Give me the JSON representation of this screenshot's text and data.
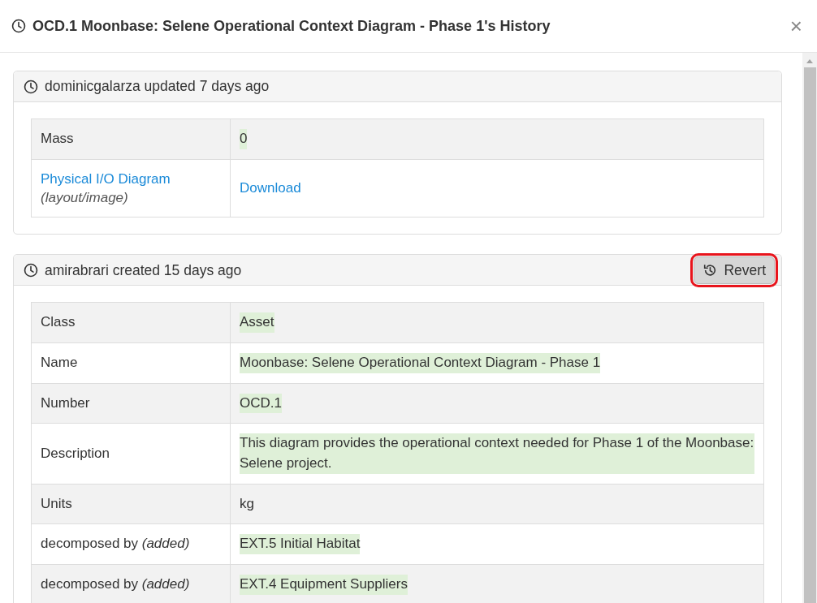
{
  "dialog": {
    "title": "OCD.1 Moonbase: Selene Operational Context Diagram - Phase 1's History",
    "close": "×"
  },
  "entries": [
    {
      "summary": "dominicgalarza updated 7 days ago",
      "rows": [
        {
          "kind": "field",
          "label": "Mass",
          "value": "0",
          "highlighted": true
        },
        {
          "kind": "attachment",
          "label": "Physical I/O Diagram",
          "sublabel": "(layout/image)",
          "value": "Download",
          "highlighted": false
        }
      ]
    },
    {
      "summary": "amirabrari created 15 days ago",
      "action": {
        "label": "Revert",
        "outlined": true
      },
      "rows": [
        {
          "kind": "field",
          "label": "Class",
          "value": "Asset",
          "highlighted": true
        },
        {
          "kind": "field",
          "label": "Name",
          "value": "Moonbase: Selene Operational Context Diagram - Phase 1",
          "highlighted": true
        },
        {
          "kind": "field",
          "label": "Number",
          "value": "OCD.1",
          "highlighted": true
        },
        {
          "kind": "field",
          "label": "Description",
          "value": "This diagram provides the operational context needed for Phase 1 of the Moonbase: Selene project.",
          "highlighted": true
        },
        {
          "kind": "field",
          "label": "Units",
          "value": "kg",
          "highlighted": false
        },
        {
          "kind": "field",
          "label": "decomposed by *(added)*",
          "value": "EXT.5 Initial Habitat",
          "highlighted": true
        },
        {
          "kind": "field",
          "label": "decomposed by *(added)*",
          "value": "EXT.4 Equipment Suppliers",
          "highlighted": true
        }
      ]
    }
  ]
}
